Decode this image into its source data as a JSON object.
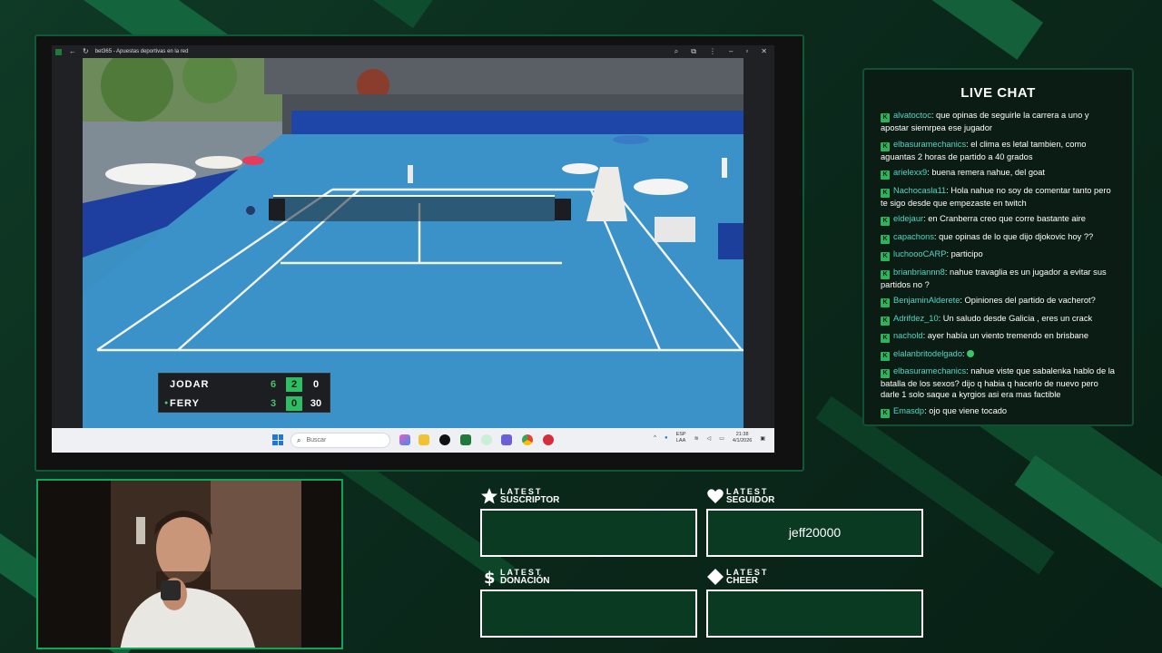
{
  "browser": {
    "title": "bet365 - Apuestas deportivas en la red"
  },
  "scoreboard": {
    "players": [
      {
        "name": "JODAR",
        "set": "6",
        "game": "2",
        "points": "0",
        "serving": false
      },
      {
        "name": "FERY",
        "set": "3",
        "game": "0",
        "points": "30",
        "serving": true
      }
    ],
    "colors": {
      "set": "#48c06f",
      "game_bg": "#2dbd63"
    }
  },
  "taskbar": {
    "search_placeholder": "Buscar",
    "language": "ESP",
    "language_sub": "LAA",
    "time": "21:38",
    "date": "4/1/2026"
  },
  "chat": {
    "title": "LIVE CHAT",
    "messages": [
      {
        "user": "alvatoctoc",
        "text": ": que opinas de seguirle la carrera a uno y apostar siemrpea ese jugador"
      },
      {
        "user": "elbasuramechanics",
        "text": ": el clima es letal tambien, como aguantas 2 horas de partido a 40 grados"
      },
      {
        "user": "arielexx9",
        "text": ": buena remera nahue, del goat"
      },
      {
        "user": "Nachocasla11",
        "text": ": Hola nahue no soy de comentar tanto pero te sigo desde que empezaste en twitch"
      },
      {
        "user": "eldejaur",
        "text": ": en Cranberra creo que corre bastante aire"
      },
      {
        "user": "capachons",
        "text": ": que opinas de lo que dijo djokovic hoy ??"
      },
      {
        "user": "luchoooCARP",
        "text": ": participo"
      },
      {
        "user": "brianbriannn8",
        "text": ": nahue travaglia es un jugador a evitar sus partidos no ?"
      },
      {
        "user": "BenjaminAlderete",
        "text": ": Opiniones del partido de vacherot?"
      },
      {
        "user": "Adrifdez_10",
        "text": ": Un saludo desde Galicia , eres un crack"
      },
      {
        "user": "nachold",
        "text": ": ayer había un viento tremendo en brisbane"
      },
      {
        "user": "elalanbritodelgado",
        "text": ": "
      },
      {
        "user": "elbasuramechanics",
        "text": ": nahue viste que sabalenka hablo de la batalla de los sexos? dijo q habia q hacerlo de nuevo pero darle 1 solo saque a kyrgios asi era mas factible"
      },
      {
        "user": "Emasdp",
        "text": ": ojo que viene tocado"
      }
    ],
    "colors": {
      "username": "#53d7c1",
      "badge": "#2fb25c"
    }
  },
  "latest": {
    "suscriptor": {
      "l1": "LATEST",
      "l2": "SUSCRIPTOR",
      "value": ""
    },
    "seguidor": {
      "l1": "LATEST",
      "l2": "SEGUIDOR",
      "value": "jeff20000"
    },
    "donacion": {
      "l1": "LATEST",
      "l2": "DONACIÓN",
      "value": ""
    },
    "cheer": {
      "l1": "LATEST",
      "l2": "CHEER",
      "value": ""
    }
  },
  "theme": {
    "accent": "#10a65a",
    "background": "#0b2a1c"
  }
}
